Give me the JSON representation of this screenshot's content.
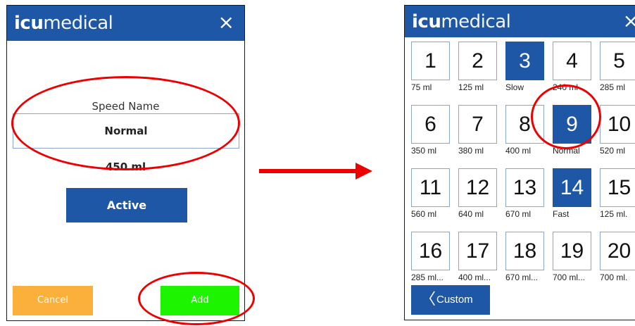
{
  "brand": {
    "bold": "icu",
    "light": "medical"
  },
  "close_glyph": "×",
  "edit_form": {
    "speed_label": "Speed Name",
    "speed_value": "Normal",
    "volume": "450 ml",
    "active_label": "Active",
    "cancel_label": "Cancel",
    "add_label": "Add"
  },
  "speed_grid": [
    {
      "num": "1",
      "label": "75 ml",
      "selected": false
    },
    {
      "num": "2",
      "label": "125 ml",
      "selected": false
    },
    {
      "num": "3",
      "label": "Slow",
      "selected": true
    },
    {
      "num": "4",
      "label": "240 ml",
      "selected": false
    },
    {
      "num": "5",
      "label": "285 ml",
      "selected": false
    },
    {
      "num": "6",
      "label": "350 ml",
      "selected": false
    },
    {
      "num": "7",
      "label": "380 ml",
      "selected": false
    },
    {
      "num": "8",
      "label": "400 ml",
      "selected": false
    },
    {
      "num": "9",
      "label": "Normal",
      "selected": true
    },
    {
      "num": "10",
      "label": "520 ml",
      "selected": false
    },
    {
      "num": "11",
      "label": "560 ml",
      "selected": false
    },
    {
      "num": "12",
      "label": "640 ml",
      "selected": false
    },
    {
      "num": "13",
      "label": "670 ml",
      "selected": false
    },
    {
      "num": "14",
      "label": "Fast",
      "selected": true
    },
    {
      "num": "15",
      "label": "125 ml.",
      "selected": false
    },
    {
      "num": "16",
      "label": "285 ml...",
      "selected": false
    },
    {
      "num": "17",
      "label": "400 ml...",
      "selected": false
    },
    {
      "num": "18",
      "label": "670 ml...",
      "selected": false
    },
    {
      "num": "19",
      "label": "700 ml...",
      "selected": false
    },
    {
      "num": "20",
      "label": "700 ml.",
      "selected": false
    }
  ],
  "custom_button": {
    "chevron": "〈",
    "label": "Custom"
  },
  "colors": {
    "brand_blue": "#1e57a6",
    "cancel_orange": "#fbb03b",
    "add_green": "#1cf400",
    "highlight_red": "#ee0000"
  }
}
